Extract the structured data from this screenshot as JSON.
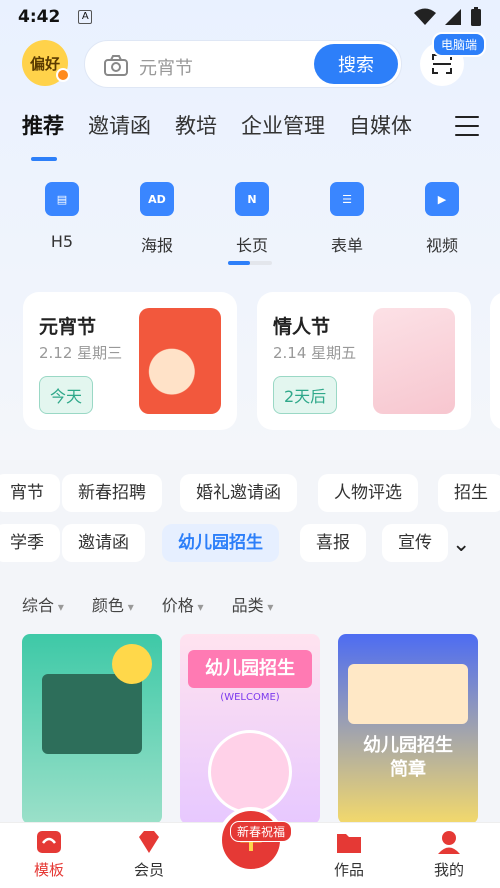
{
  "status": {
    "time": "4:42"
  },
  "topbar": {
    "pref_label": "偏好",
    "search_placeholder": "元宵节",
    "search_button": "搜索",
    "pc_badge": "电脑端"
  },
  "tabs": [
    "推荐",
    "邀请函",
    "教培",
    "企业管理",
    "自媒体"
  ],
  "categories": [
    {
      "label": "H5",
      "icon": "h5-icon"
    },
    {
      "label": "海报",
      "icon": "poster-icon"
    },
    {
      "label": "长页",
      "icon": "long-page-icon"
    },
    {
      "label": "表单",
      "icon": "form-icon"
    },
    {
      "label": "视频",
      "icon": "video-icon"
    }
  ],
  "festivals": [
    {
      "name": "元宵节",
      "date": "2.12  星期三",
      "tag": "今天"
    },
    {
      "name": "情人节",
      "date": "2.14  星期五",
      "tag": "2天后"
    }
  ],
  "chips_row1": [
    "宵节",
    "新春招聘",
    "婚礼邀请函",
    "人物评选",
    "招生"
  ],
  "chips_row2": [
    "学季",
    "邀请函",
    "幼儿园招生",
    "喜报",
    "宣传"
  ],
  "filters": [
    "综合",
    "颜色",
    "价格",
    "品类"
  ],
  "cards": [
    {
      "text": ""
    },
    {
      "title": "幼儿园招生",
      "sub": "(WELCOME)"
    },
    {
      "title": "幼儿园招生简章"
    }
  ],
  "bottom_nav": [
    "模板",
    "会员",
    "",
    "作品",
    "我的"
  ],
  "bottom_badge": "新春祝福",
  "colors": {
    "accent": "#2d7ff9",
    "brand_red": "#e53935"
  }
}
